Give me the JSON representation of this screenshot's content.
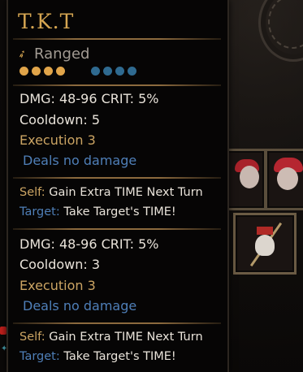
{
  "skill": {
    "name": "T.K.T",
    "type_label": "Ranged",
    "type_icon": "bow-icon",
    "rank_pips": {
      "gold_count": 4,
      "blue_count": 4,
      "gold_color": "#e1a54a",
      "blue_color": "#2f6a90"
    }
  },
  "blocks": [
    {
      "stats": "DMG: 48-96   CRIT: 5%",
      "cooldown": "Cooldown: 5",
      "execution": "Execution 3",
      "effect": "Deals no damage",
      "self_label": "Self:",
      "self_text": "Gain Extra TIME Next Turn",
      "target_label": "Target:",
      "target_text": "Take Target's TIME!"
    },
    {
      "stats": "DMG: 48-96   CRIT: 5%",
      "cooldown": "Cooldown: 3",
      "execution": "Execution 3",
      "effect": "Deals no damage",
      "self_label": "Self:",
      "self_text": "Gain Extra TIME Next Turn",
      "target_label": "Target:",
      "target_text": "Take Target's TIME!"
    }
  ],
  "colors": {
    "title": "#d6a652",
    "gold_text": "#cba463",
    "blue_text": "#4f7fb8",
    "white_text": "#e9e3da",
    "divider": "#8c6a3e"
  }
}
